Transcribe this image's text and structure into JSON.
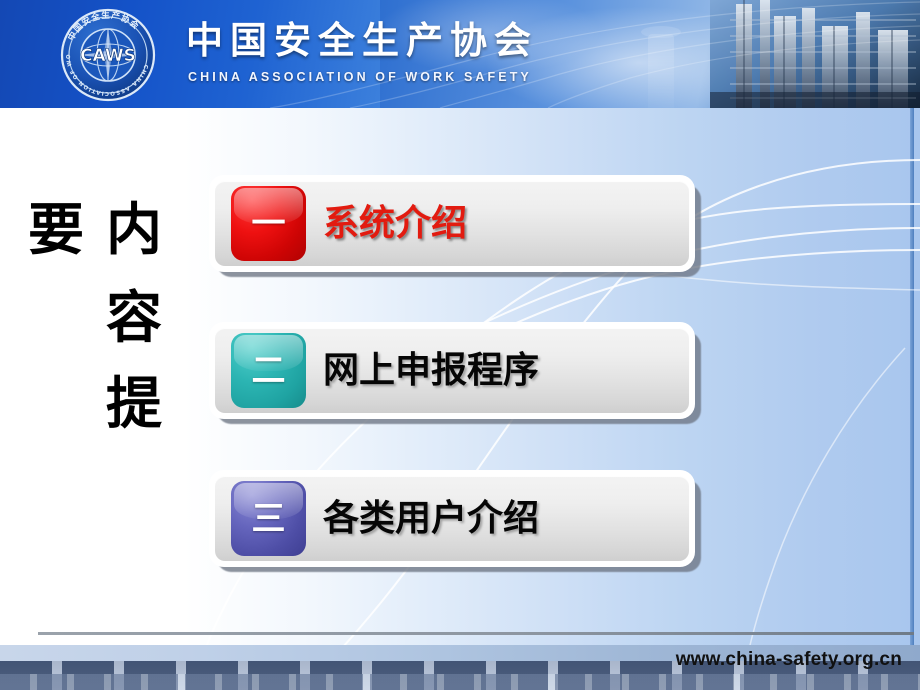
{
  "header": {
    "logo_alt": "caws-emblem",
    "title": "中国安全生产协会",
    "subtitle": "CHINA ASSOCIATION OF WORK SAFETY"
  },
  "heading": {
    "chars": [
      "要",
      "内",
      "容",
      "提"
    ],
    "full_text": "内容提要"
  },
  "agenda": {
    "items": [
      {
        "number": "一",
        "label": "系统介绍",
        "chip_color": "#e01111",
        "label_color": "#e21b10"
      },
      {
        "number": "二",
        "label": "网上申报程序",
        "chip_color": "#2cb5b3",
        "label_color": "#060606"
      },
      {
        "number": "三",
        "label": "各类用户介绍",
        "chip_color": "#5353ac",
        "label_color": "#060606"
      }
    ]
  },
  "footer": {
    "url": "www.china-safety.org.cn"
  }
}
